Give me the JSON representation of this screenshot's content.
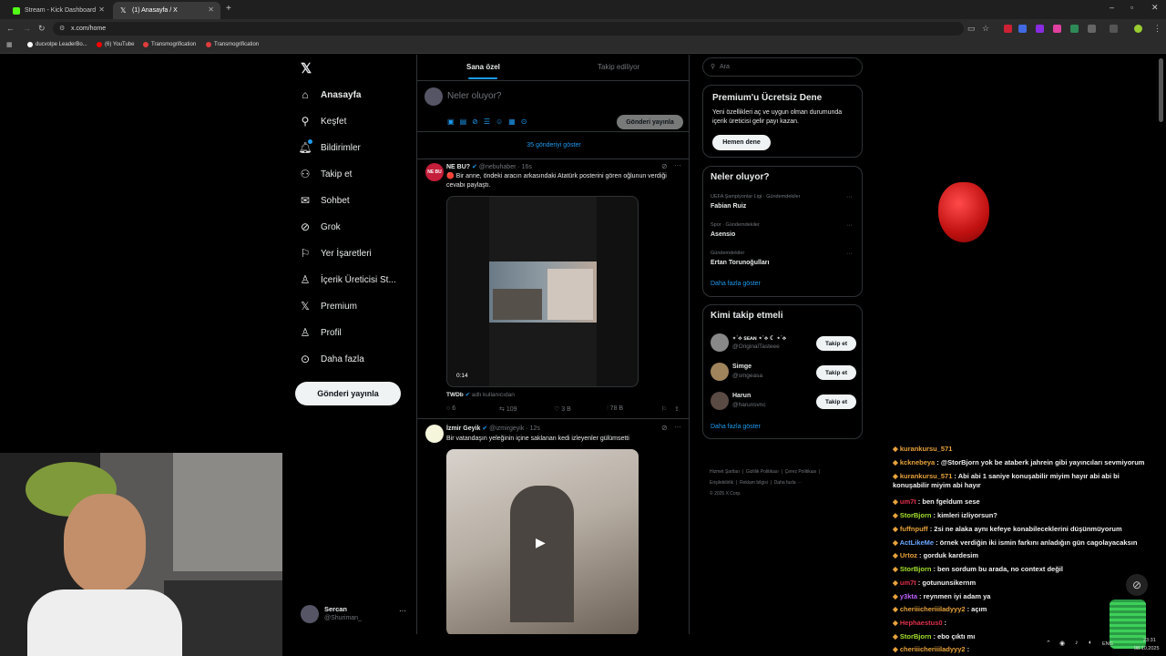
{
  "browser": {
    "tabs": [
      {
        "label": "Stream - Kick Dashboard",
        "active": false,
        "favicon_color": "#53fc18"
      },
      {
        "label": "(1) Anasayfa / X",
        "active": true,
        "favicon_color": "#ffffff"
      }
    ],
    "url": "x.com/home",
    "bookmarks": [
      {
        "label": "ducvolpe LeaderBo...",
        "icon_color": "#ffffff"
      },
      {
        "label": "(6) YouTube",
        "icon_color": "#ff0000"
      },
      {
        "label": "Transmogrification",
        "icon_color": "#e03c3c"
      },
      {
        "label": "Transmogrification",
        "icon_color": "#e03c3c"
      }
    ]
  },
  "sidebar": {
    "items": [
      {
        "label": "Anasayfa",
        "icon": "home-icon",
        "glyph": "⌂",
        "bold": true
      },
      {
        "label": "Keşfet",
        "icon": "search-icon",
        "glyph": "⚲"
      },
      {
        "label": "Bildirimler",
        "icon": "bell-icon",
        "glyph": "♫"
      },
      {
        "label": "Takip et",
        "icon": "add-person-icon",
        "glyph": "♟"
      },
      {
        "label": "Sohbet",
        "icon": "mail-icon",
        "glyph": "✉"
      },
      {
        "label": "Grok",
        "icon": "grok-icon",
        "glyph": "⊘"
      },
      {
        "label": "Yer İşaretleri",
        "icon": "bookmark-icon",
        "glyph": "⚑"
      },
      {
        "label": "İçerik Üreticisi St...",
        "icon": "creator-icon",
        "glyph": "♙"
      },
      {
        "label": "Premium",
        "icon": "x-logo-icon",
        "glyph": "✕"
      },
      {
        "label": "Profil",
        "icon": "profile-icon",
        "glyph": "♙"
      },
      {
        "label": "Daha fazla",
        "icon": "more-circle-icon",
        "glyph": "⊙"
      }
    ],
    "post_button": "Gönderi yayınla",
    "account": {
      "name": "Sercan",
      "handle": "@Shuriman_"
    }
  },
  "timeline": {
    "tabs": [
      "Sana özel",
      "Takip ediliyor"
    ],
    "composer_placeholder": "Neler oluyor?",
    "composer_button": "Gönderi yayınla",
    "show_more": "35 gönderiyi göster",
    "tweets": [
      {
        "name": "NE BU?",
        "handle": "@nebuhaber · 16s",
        "text": "🔴 Bir anne, öndeki aracın arkasındaki Atatürk posterini gören oğlunun verdiği cevabı paylaştı.",
        "video_time": "0:14",
        "source_name": "TWDb",
        "source_text": "adlı kullanıcıdan",
        "stats": {
          "replies": "6",
          "reposts": "109",
          "likes": "3 B",
          "views": "78 B"
        }
      },
      {
        "name": "İzmir Geyik",
        "handle": "@izmirgeyik · 12s",
        "text": "Bir vatandaşın yeleğinin içine saklanan kedi izleyenler gülümsetti"
      }
    ]
  },
  "right": {
    "search_placeholder": "Ara",
    "premium": {
      "title": "Premium'u Ücretsiz Dene",
      "text": "Yeni özellikleri aç ve uygun olman durumunda içerik üreticisi gelir payı kazan.",
      "button": "Hemen dene"
    },
    "trends": {
      "title": "Neler oluyor?",
      "items": [
        {
          "context": "UEFA Şampiyonlar Ligi · Gündemdekiler",
          "name": "Fabian Ruiz"
        },
        {
          "context": "Spor · Gündemdekiler",
          "name": "Asensio"
        },
        {
          "context": "Gündemdekiler",
          "name": "Ertan Torunoğulları"
        }
      ],
      "show_more": "Daha fazla göster"
    },
    "who_to_follow": {
      "title": "Kimi takip etmeli",
      "items": [
        {
          "name": "⋆˙⟡ ꜱᴇᴀɴ ⋆˙⟡ ☾ ⋆˙⟡",
          "handle": "@OriginalTasteee",
          "button": "Takip et"
        },
        {
          "name": "Simge",
          "handle": "@smgeasa",
          "button": "Takip et"
        },
        {
          "name": "Harun",
          "handle": "@harunsvnc",
          "button": "Takip et"
        }
      ],
      "show_more": "Daha fazla göster"
    },
    "footer": [
      "Hizmet Şartları",
      "Gizlilik Politikası",
      "Çerez Politikası",
      "Erişilebilirlik",
      "Reklam bilgisi",
      "Daha fazla ···",
      "© 2025 X Corp."
    ]
  },
  "chat": [
    {
      "user": "kurankursu_571",
      "text": "",
      "color": "#e8a33a"
    },
    {
      "user": "kcknebeya",
      "text": ": @StorBjorn yok be ataberk jahrein gibi yayıncıları sevmiyorum",
      "color": "#e8a33a"
    },
    {
      "user": "kurankursu_571",
      "text": ": Abi abi 1 saniye konuşabilir miyim hayır abi abi bi konuşabilir miyim abi hayır",
      "color": "#e8a33a"
    },
    {
      "user": "um7t",
      "text": ": ben fgeldum sese",
      "color": "#e0314a"
    },
    {
      "user": "StorBjorn",
      "text": ": kimleri izliyorsun?",
      "color": "#a6e22e"
    },
    {
      "user": "fuffnpuff",
      "text": ": 2si ne alaka aynı kefeye konabileceklerini düşünmüyorum",
      "color": "#e8a33a"
    },
    {
      "user": "ActLikeMe",
      "text": ": örnek verdiğin iki ismin farkını anladığın gün cagolayacaksın",
      "color": "#6aa7ff"
    },
    {
      "user": "Urtoz",
      "text": ": gorduk kardesim",
      "color": "#e8a33a"
    },
    {
      "user": "StorBjorn",
      "text": ": ben sordum bu arada, no context değil",
      "color": "#a6e22e"
    },
    {
      "user": "um7t",
      "text": ": gotununsikernm",
      "color": "#e0314a"
    },
    {
      "user": "y3kta",
      "text": ": reynmen iyi adam ya",
      "color": "#c061ff"
    },
    {
      "user": "cheriiicheriiiladyyy2",
      "text": ": açım",
      "color": "#e8a33a"
    },
    {
      "user": "Hephaestus0",
      "text": ":",
      "color": "#e0314a"
    },
    {
      "user": "StorBjorn",
      "text": ": ebo çıktı mı",
      "color": "#a6e22e"
    },
    {
      "user": "cheriiicheriiiladyyy2",
      "text": ":",
      "color": "#e8a33a"
    }
  ],
  "taskbar": {
    "lang": "ENG",
    "time": "23:31",
    "date": "08.10.2025"
  }
}
